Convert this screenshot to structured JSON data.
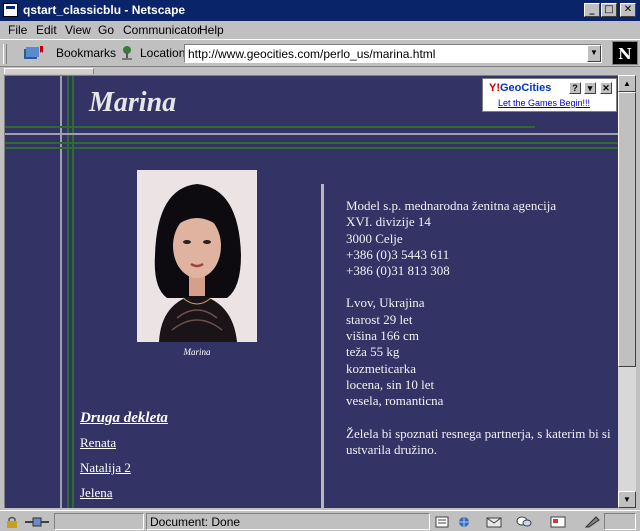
{
  "window": {
    "title": "qstart_classicblu - Netscape"
  },
  "menu": [
    "File",
    "Edit",
    "View",
    "Go",
    "Communicator",
    "Help"
  ],
  "toolbar": {
    "bookmarks_label": "Bookmarks",
    "location_label": "Location:",
    "url": "http://www.geocities.com/perlo_us/marina.html",
    "logo_letter": "N"
  },
  "geocities": {
    "brand_y": "Y!",
    "brand_name": "GeoCities",
    "help": "?",
    "tagline": "Let the Games Begin!!!"
  },
  "page": {
    "title": "Marina",
    "photo_caption": "Marina",
    "sidebar_heading": "Druga dekleta",
    "sidebar_links": [
      "Renata",
      "Natalija 2",
      "Jelena"
    ],
    "agency": [
      "Model s.p. mednarodna ženitna agencija",
      "XVI. divizije 14",
      "3000 Celje",
      "+386 (0)3 5443 611",
      "+386 (0)31 813 308"
    ],
    "profile": [
      "Lvov, Ukrajina",
      "starost 29 let",
      "višina 166 cm",
      "teža 55 kg",
      "kozmeticarka",
      "locena, sin 10 let",
      "vesela, romanticna"
    ],
    "message": "Želela bi spoznati resnega partnerja, s katerim bi si ustvarila družino."
  },
  "status": {
    "text": "Document: Done"
  },
  "colors": {
    "page_bg": "#333366",
    "green_line": "#2f6b2f",
    "gray_line": "#a0a0a8"
  }
}
